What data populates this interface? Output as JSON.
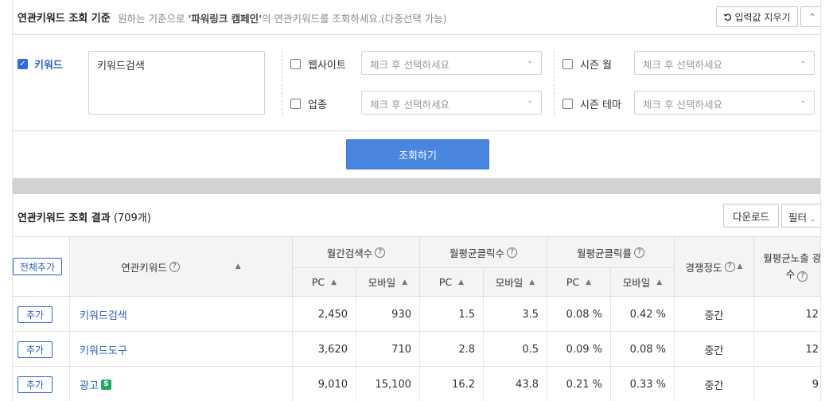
{
  "criteria": {
    "title": "연관키워드 조회 기준",
    "desc_prefix": "원하는 기준으로 ",
    "desc_bold": "'파워링크 캠페인'",
    "desc_suffix": "의 연관키워드를 조회하세요.(다중선택 가능)",
    "reset_label": "입력값 지우기",
    "collapse_icon": "chevron-up",
    "keyword_label": "키워드",
    "keyword_checked": true,
    "keyword_value": "키워드검색",
    "website_label": "웹사이트",
    "industry_label": "업종",
    "season_month_label": "시즌 월",
    "season_theme_label": "시즌 테마",
    "select_placeholder": "체크 후 선택하세요",
    "search_button": "조회하기"
  },
  "results": {
    "title": "연관키워드 조회 결과",
    "count": "(709개)",
    "download_label": "다운로드",
    "filter_label": "필터",
    "add_all_label": "전체추가",
    "headers": {
      "keyword": "연관키워드",
      "monthly_search": "월간검색수",
      "avg_clicks": "월평균클릭수",
      "avg_ctr": "월평균클릭률",
      "competition": "경쟁정도",
      "avg_ads": "월평균노출 광고수",
      "pc": "PC",
      "mobile": "모바일"
    },
    "add_label": "추가",
    "rows": [
      {
        "keyword": "키워드검색",
        "badge": "",
        "search_pc": "2,450",
        "search_mobile": "930",
        "click_pc": "1.5",
        "click_mobile": "3.5",
        "ctr_pc": "0.08 %",
        "ctr_mobile": "0.42 %",
        "competition": "중간",
        "ads": "12"
      },
      {
        "keyword": "키워드도구",
        "badge": "",
        "search_pc": "3,620",
        "search_mobile": "710",
        "click_pc": "2.8",
        "click_mobile": "0.5",
        "ctr_pc": "0.09 %",
        "ctr_mobile": "0.08 %",
        "competition": "중간",
        "ads": "12"
      },
      {
        "keyword": "광고",
        "badge": "S",
        "search_pc": "9,010",
        "search_mobile": "15,100",
        "click_pc": "16.2",
        "click_mobile": "43.8",
        "ctr_pc": "0.21 %",
        "ctr_mobile": "0.33 %",
        "competition": "중간",
        "ads": "9"
      }
    ]
  },
  "colors": {
    "accent": "#2d62c8",
    "primary_button": "#4a86e0",
    "badge_green": "#1faa6a"
  }
}
